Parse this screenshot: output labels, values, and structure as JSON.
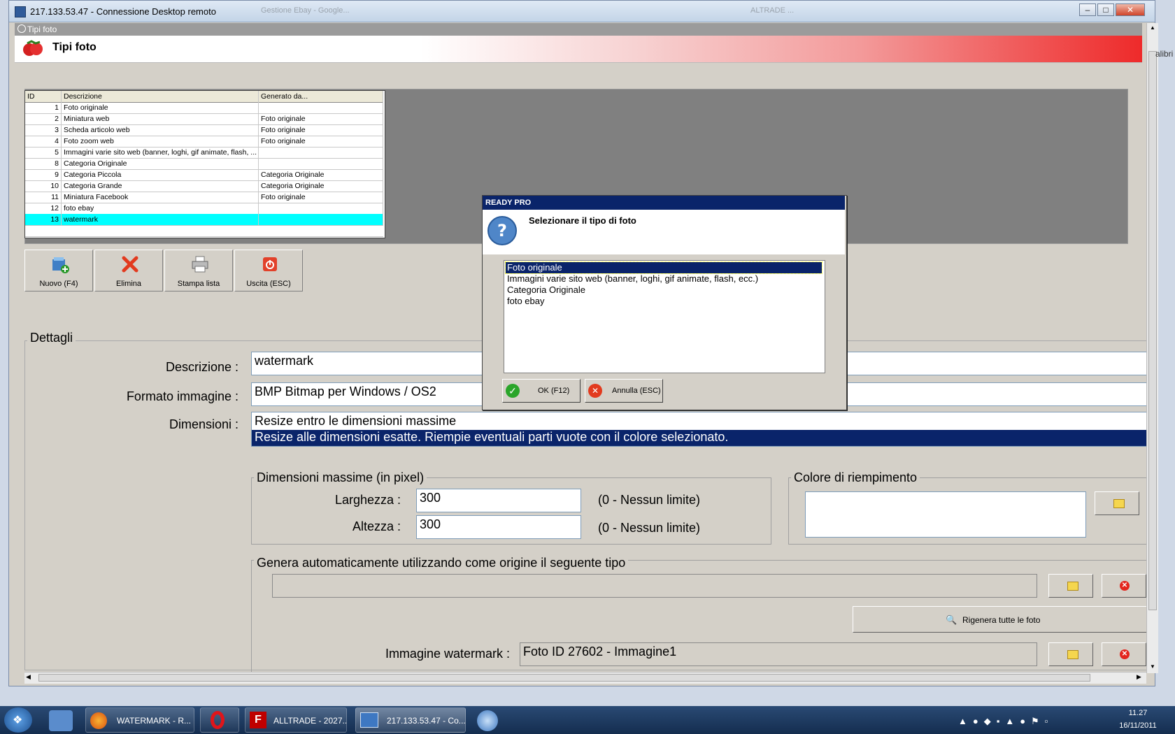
{
  "rdp": {
    "title": "217.133.53.47 - Connessione Desktop remoto"
  },
  "ghost": {
    "tab1": "Gestione Ebay - Google...",
    "tab2": "ALTRADE ...",
    "right_text": "alibri"
  },
  "app": {
    "window_title": "Tipi foto",
    "banner_title": "Tipi foto"
  },
  "grid": {
    "headers": [
      "ID",
      "Descrizione",
      "Generato da..."
    ],
    "rows": [
      {
        "id": "1",
        "desc": "Foto originale",
        "gen": ""
      },
      {
        "id": "2",
        "desc": "Miniatura web",
        "gen": "Foto originale"
      },
      {
        "id": "3",
        "desc": "Scheda articolo web",
        "gen": "Foto originale"
      },
      {
        "id": "4",
        "desc": "Foto zoom web",
        "gen": "Foto originale"
      },
      {
        "id": "5",
        "desc": "Immagini varie sito web (banner, loghi, gif animate, flash, ...",
        "gen": ""
      },
      {
        "id": "8",
        "desc": "Categoria Originale",
        "gen": ""
      },
      {
        "id": "9",
        "desc": "Categoria Piccola",
        "gen": "Categoria Originale"
      },
      {
        "id": "10",
        "desc": "Categoria Grande",
        "gen": "Categoria Originale"
      },
      {
        "id": "11",
        "desc": "Miniatura Facebook",
        "gen": "Foto originale"
      },
      {
        "id": "12",
        "desc": "foto ebay",
        "gen": ""
      },
      {
        "id": "13",
        "desc": "watermark",
        "gen": ""
      }
    ]
  },
  "toolbar": {
    "new": "Nuovo (F4)",
    "delete": "Elimina",
    "print": "Stampa lista",
    "exit": "Uscita (ESC)"
  },
  "details": {
    "title": "Dettagli",
    "desc_label": "Descrizione :",
    "desc_value": "watermark",
    "format_label": "Formato immagine :",
    "format_value": "BMP Bitmap per Windows / OS2",
    "dim_label": "Dimensioni :",
    "dim_opt1": "Resize entro le dimensioni massime",
    "dim_opt2": "Resize alle dimensioni esatte. Riempie eventuali parti vuote con il colore selezionato.",
    "maxdim_title": "Dimensioni massime (in pixel)",
    "width_label": "Larghezza :",
    "width_value": "300",
    "height_label": "Altezza :",
    "height_value": "300",
    "limit_hint": "(0 - Nessun limite)",
    "fill_title": "Colore di riempimento",
    "auto_title": "Genera automaticamente utilizzando come origine il seguente tipo",
    "regen": "Rigenera tutte le foto",
    "wm_label": "Immagine watermark :",
    "wm_value": "Foto ID 27602 - Immagine1"
  },
  "dialog": {
    "title": "READY PRO",
    "message": "Selezionare il tipo di foto",
    "options": [
      "Foto originale",
      "Immagini varie sito web (banner, loghi, gif animate, flash, ecc.)",
      "Categoria Originale",
      "foto ebay"
    ],
    "ok": "OK (F12)",
    "cancel": "Annulla (ESC)"
  },
  "taskbar": {
    "t1": "WATERMARK - R...",
    "t2": "ALLTRADE - 2027...",
    "t3": "217.133.53.47 - Co...",
    "time": "11.27",
    "date": "16/11/2011"
  }
}
